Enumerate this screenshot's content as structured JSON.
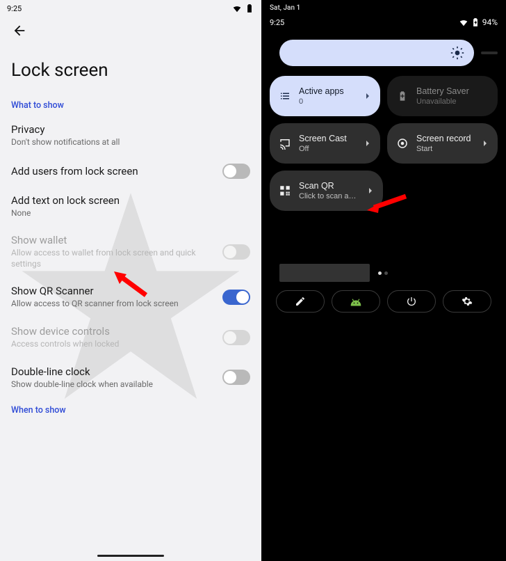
{
  "left": {
    "status": {
      "time": "9:25"
    },
    "page_title": "Lock screen",
    "section_what": "What to show",
    "section_when": "When to show",
    "items": {
      "privacy": {
        "title": "Privacy",
        "sub": "Don't show notifications at all"
      },
      "add_users": {
        "title": "Add users from lock screen"
      },
      "add_text": {
        "title": "Add text on lock screen",
        "sub": "None"
      },
      "show_wallet": {
        "title": "Show wallet",
        "sub": "Allow access to wallet from lock screen and quick settings"
      },
      "show_qr": {
        "title": "Show QR Scanner",
        "sub": "Allow access to QR scanner from lock screen"
      },
      "device_controls": {
        "title": "Show device controls",
        "sub": "Access controls when locked"
      },
      "double_clock": {
        "title": "Double-line clock",
        "sub": "Show double-line clock when available"
      }
    }
  },
  "right": {
    "date": "Sat, Jan 1",
    "time": "9:25",
    "battery_pct": "94%",
    "tiles": {
      "active_apps": {
        "title": "Active apps",
        "sub": "0"
      },
      "battery_saver": {
        "title": "Battery Saver",
        "sub": "Unavailable"
      },
      "screen_cast": {
        "title": "Screen Cast",
        "sub": "Off"
      },
      "screen_record": {
        "title": "Screen record",
        "sub": "Start"
      },
      "scan_qr": {
        "title": "Scan QR",
        "sub": "Click to scan a QR code"
      }
    }
  }
}
